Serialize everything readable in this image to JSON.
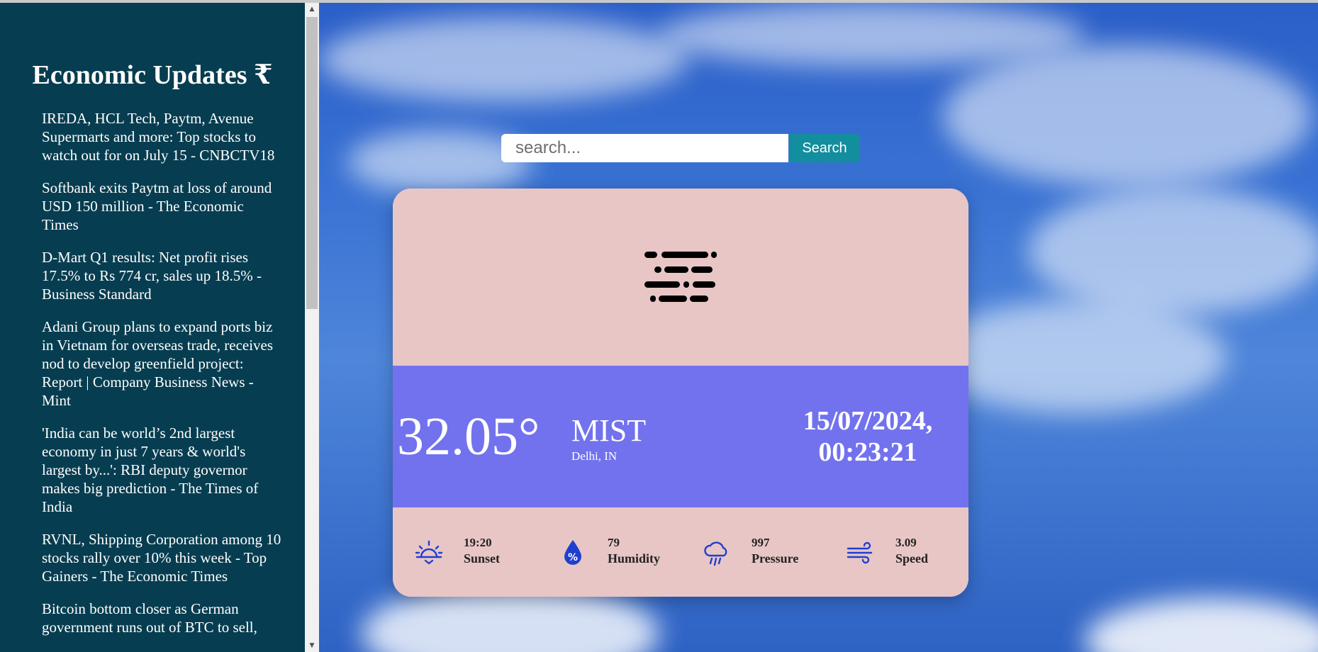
{
  "sidebar": {
    "title": "Economic Updates ₹",
    "news": [
      "IREDA, HCL Tech, Paytm, Avenue Supermarts and more: Top stocks to watch out for on July 15 - CNBCTV18",
      "Softbank exits Paytm at loss of around USD 150 million - The Economic Times",
      "D-Mart Q1 results: Net profit rises 17.5% to Rs 774 cr, sales up 18.5% - Business Standard",
      "Adani Group plans to expand ports biz in Vietnam for overseas trade, receives nod to develop greenfield project: Report | Company Business News - Mint",
      "'India can be world’s 2nd largest economy in just 7 years & world's largest by...': RBI deputy governor makes big prediction - The Times of India",
      "RVNL, Shipping Corporation among 10 stocks rally over 10% this week - Top Gainers - The Economic Times",
      "Bitcoin bottom closer as German government runs out of BTC to sell,"
    ]
  },
  "search": {
    "placeholder": "search...",
    "button_label": "Search"
  },
  "weather": {
    "icon": "mist-icon",
    "temperature": "32.05°",
    "condition": "MIST",
    "location": "Delhi, IN",
    "date": "15/07/2024,",
    "time": "00:23:21",
    "stats": {
      "sunset": {
        "value": "19:20",
        "label": "Sunset",
        "icon": "sunset-icon"
      },
      "humidity": {
        "value": "79",
        "label": "Humidity",
        "icon": "humidity-drop-icon"
      },
      "pressure": {
        "value": "997",
        "label": "Pressure",
        "icon": "rain-cloud-icon"
      },
      "speed": {
        "value": "3.09",
        "label": "Speed",
        "icon": "wind-icon"
      }
    }
  },
  "colors": {
    "sidebar_bg": "#073d50",
    "card_pink": "#e8c6c5",
    "card_purple": "#7272ee",
    "search_button": "#138e9e",
    "stat_icon": "#1f3fcf"
  }
}
